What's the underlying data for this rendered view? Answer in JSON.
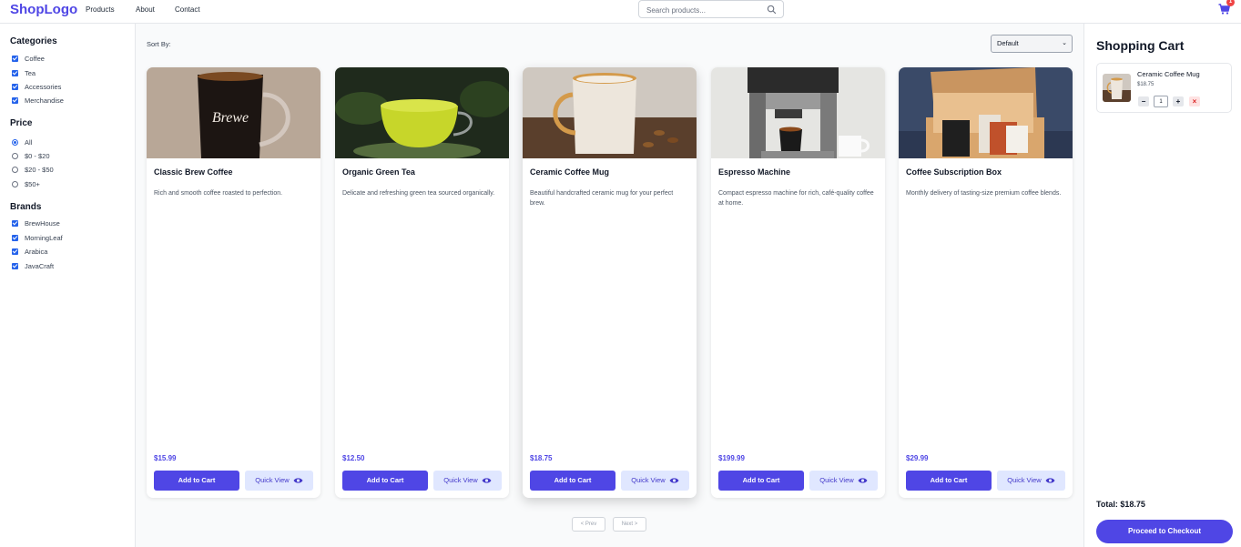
{
  "nav": {
    "logo": "ShopLogo",
    "links": [
      "Products",
      "About",
      "Contact"
    ],
    "search_placeholder": "Search products...",
    "cart_count": "1"
  },
  "sidebar": {
    "categories_heading": "Categories",
    "categories": [
      "Coffee",
      "Tea",
      "Accessories",
      "Merchandise"
    ],
    "price_heading": "Price",
    "price_options": [
      "All",
      "$0 - $20",
      "$20 - $50",
      "$50+"
    ],
    "price_selected": "All",
    "brands_heading": "Brands",
    "brands": [
      "BrewHouse",
      "MorningLeaf",
      "Arabica",
      "JavaCraft"
    ]
  },
  "toolbar": {
    "sort_label": "Sort By:",
    "sort_value": "Default"
  },
  "products": [
    {
      "title": "Classic Brew Coffee",
      "description": "Rich and smooth coffee roasted to perfection.",
      "price": "$15.99",
      "add_label": "Add to Cart",
      "quick_label": "Quick View",
      "image_text": "Brewe"
    },
    {
      "title": "Organic Green Tea",
      "description": "Delicate and refreshing green tea sourced organically.",
      "price": "$12.50",
      "add_label": "Add to Cart",
      "quick_label": "Quick View"
    },
    {
      "title": "Ceramic Coffee Mug",
      "description": "Beautiful handcrafted ceramic mug for your perfect brew.",
      "price": "$18.75",
      "add_label": "Add to Cart",
      "quick_label": "Quick View"
    },
    {
      "title": "Espresso Machine",
      "description": "Compact espresso machine for rich, café-quality coffee at home.",
      "price": "$199.99",
      "add_label": "Add to Cart",
      "quick_label": "Quick View"
    },
    {
      "title": "Coffee Subscription Box",
      "description": "Monthly delivery of tasting-size premium coffee blends.",
      "price": "$29.99",
      "add_label": "Add to Cart",
      "quick_label": "Quick View"
    }
  ],
  "pagination": {
    "prev": "< Prev",
    "next": "Next >"
  },
  "cart": {
    "title": "Shopping Cart",
    "items": [
      {
        "name": "Ceramic Coffee Mug",
        "price": "$18.75",
        "qty": "1",
        "minus": "−",
        "plus": "+",
        "remove": "×"
      }
    ],
    "total": "Total: $18.75",
    "checkout_label": "Proceed to Checkout"
  },
  "colors": {
    "accent": "#4f46e5",
    "accent_light": "#e0e7ff",
    "badge": "#ef4444"
  }
}
